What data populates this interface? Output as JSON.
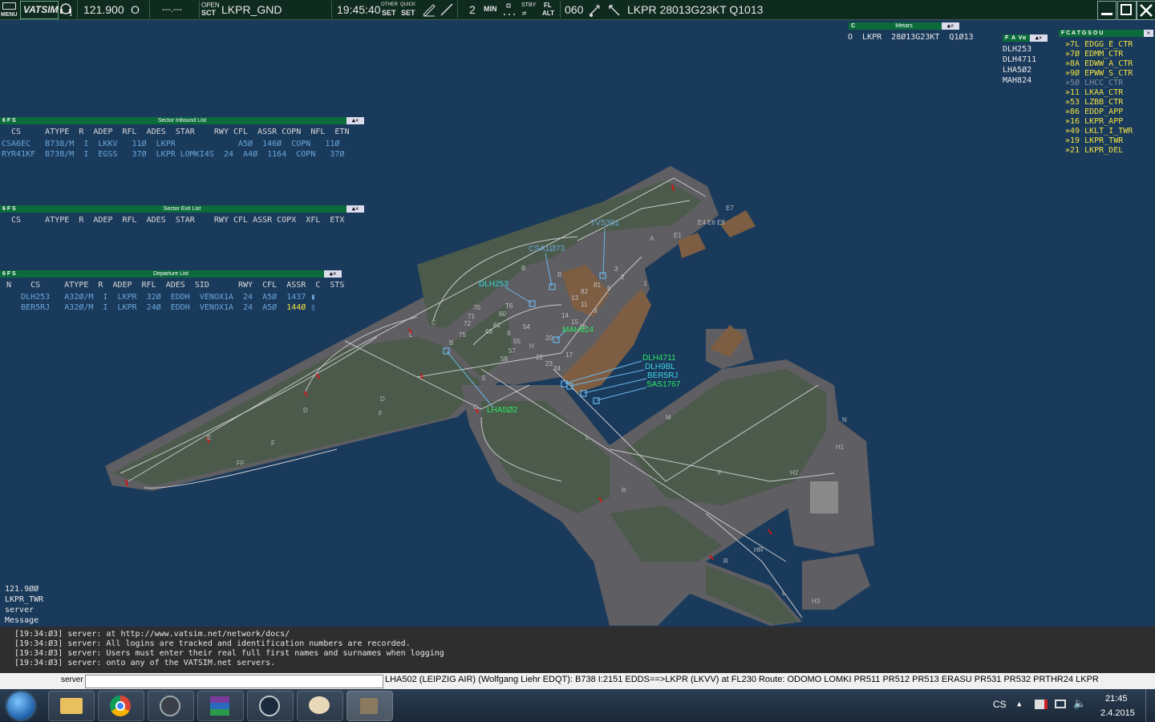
{
  "topbar": {
    "menu_label": "MENU",
    "logo": "VATSIM",
    "freq": "121.900",
    "atis_letter": "O",
    "secondary": "---.---",
    "open_sct_top": "OPEN",
    "open_sct_bottom": "SCT",
    "callsign": "LKPR_GND",
    "time": "19:45:40",
    "other_set_top": "OTHER",
    "other_set_bottom": "SET",
    "quick_set_top": "QUICK",
    "quick_set_bottom": "SET",
    "min_value": "2",
    "min_label": "MIN",
    "stby_top": "STBY",
    "fl_top": "FL",
    "fl_bottom": "ALT",
    "transition": "060",
    "metar": "LKPR 28013G23KT Q1013"
  },
  "metars_panel": {
    "title": "Metars",
    "c_label": "C",
    "line": "O  LKPR  28Ø13G23KT  Q1Ø13"
  },
  "fav_panel": {
    "title": "F A Vo",
    "items": [
      "DLH253",
      "DLH4711",
      "LHA5Ø2",
      "MAH824"
    ]
  },
  "controllers_panel": {
    "title": "F C A T G S O U",
    "items": [
      {
        "text": "»7L EDGG_E_CTR",
        "color": "#f0e040"
      },
      {
        "text": "»7Ø EDMM_CTR",
        "color": "#f0e040"
      },
      {
        "text": "»8A EDWW_A_CTR",
        "color": "#f0e040"
      },
      {
        "text": "»9Ø EPWW_S_CTR",
        "color": "#f0e040"
      },
      {
        "text": "»5Ø LHCC_CTR",
        "color": "#7f8f9f"
      },
      {
        "text": "»11 LKAA_CTR",
        "color": "#f0e040"
      },
      {
        "text": "»53 LZBB_CTR",
        "color": "#f0e040"
      },
      {
        "text": "»86 EDDP_APP",
        "color": "#f0e040"
      },
      {
        "text": "»16 LKPR_APP",
        "color": "#f0e040"
      },
      {
        "text": "»49 LKLT_I_TWR",
        "color": "#f0e040"
      },
      {
        "text": "»19 LKPR_TWR",
        "color": "#f0e040"
      },
      {
        "text": "»21 LKPR_DEL",
        "color": "#f0e040"
      }
    ]
  },
  "inbound_list": {
    "title": "Sector Inbound List",
    "flags": "6 F S",
    "header": "  CS     ATYPE  R  ADEP  RFL  ADES  STAR    RWY CFL  ASSR COPN  NFL  ETN",
    "rows": [
      "CSA6EC   B738/M  I  LKKV   11Ø  LKPR             A5Ø  146Ø  COPN   11Ø",
      "RYR41KF  B738/M  I  EGSS   37Ø  LKPR LOMKI4S  24  A4Ø  1164  COPN   37Ø"
    ]
  },
  "exit_list": {
    "title": "Sector Exit List",
    "flags": "6 F S",
    "header": "  CS     ATYPE  R  ADEP  RFL  ADES  STAR    RWY CFL ASSR COPX  XFL  ETX"
  },
  "departure_list": {
    "title": "Departure List",
    "flags": "6 F S",
    "header": " N    CS     ATYPE  R  ADEP  RFL  ADES  SID      RWY  CFL  ASSR  C  STS",
    "rows": [
      {
        "pre": "    DLH253   A32Ø/M  I  LKPR  32Ø  EDDH  VENOX1A  24  A5Ø  ",
        "assr": "1437",
        "post": " ",
        "sts": "▮",
        "assr_color": "#6aa6d8"
      },
      {
        "pre": "    BER5RJ   A32Ø/M  I  LKPR  24Ø  EDDH  VENOX1A  24  A5Ø  ",
        "assr": "144Ø",
        "post": " ",
        "sts": "▯",
        "assr_color": "#f0e040"
      }
    ]
  },
  "radar_labels": {
    "tvs381": "TVS381",
    "csa1073": "CSA1Ø73",
    "dlh253": "DLH253",
    "mah824": "MAH824",
    "dlh4711": "DLH4711",
    "dlh9bl": "DLH9BL",
    "ber5rj": "BER5RJ",
    "sas1767": "SAS1767",
    "lha502": "LHA5Ø2"
  },
  "bottom_left": {
    "freq": "121.9ØØ",
    "station": "LKPR_TWR",
    "line3": "server",
    "line4": "Message"
  },
  "messages": [
    "[19:34:Ø3] server: at http://www.vatsim.net/network/docs/",
    "[19:34:Ø3] server: All logins are tracked and identification numbers are recorded.",
    "[19:34:Ø3] server: Users must enter their real full first names and surnames when logging",
    "[19:34:Ø3] server: onto any of the VATSIM.net servers."
  ],
  "command": {
    "label": "server",
    "info": "LHA502 (LEIPZIG AIR) (Wolfgang Liehr EDQT): B738 I:2151 EDDS==>LKPR (LKVV) at FL230 Route: ODOMO LOMKI PR511 PR512 PR513 ERASU PR531 PR532 PRTHR24 LKPR"
  },
  "taskbar": {
    "lang": "CS",
    "time": "21:45",
    "date": "2.4.2015"
  },
  "colors": {
    "background": "#1a3a5c",
    "apron": "#5f5e62",
    "grass": "#4b5a4a",
    "building": "#7e5e42",
    "list_text": "#6aa6d8",
    "controller_text": "#f0e040"
  }
}
